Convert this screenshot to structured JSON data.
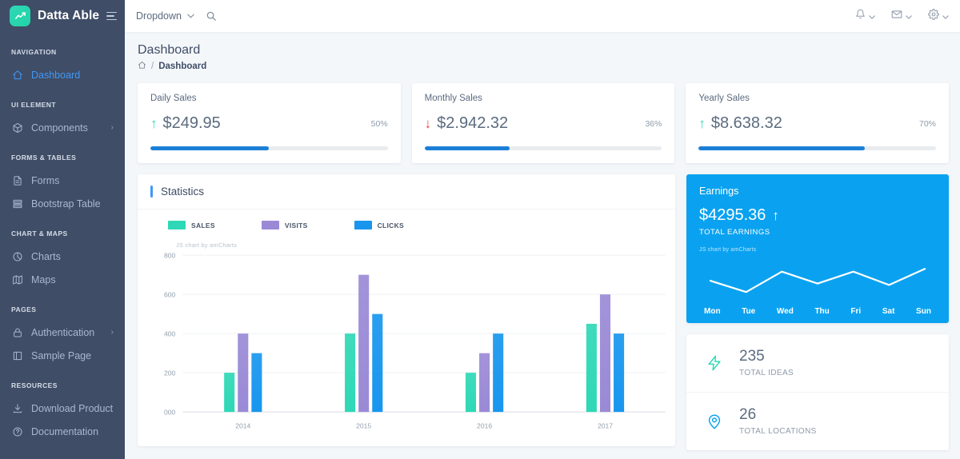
{
  "sidebar": {
    "brand": "Datta Able",
    "groups": [
      {
        "caption": "NAVIGATION",
        "items": [
          {
            "label": "Dashboard",
            "icon": "home-icon",
            "active": true,
            "arrow": ""
          }
        ]
      },
      {
        "caption": "UI ELEMENT",
        "items": [
          {
            "label": "Components",
            "icon": "cube-icon",
            "active": false,
            "arrow": "›"
          }
        ]
      },
      {
        "caption": "FORMS & TABLES",
        "items": [
          {
            "label": "Forms",
            "icon": "form-icon",
            "active": false,
            "arrow": ""
          },
          {
            "label": "Bootstrap Table",
            "icon": "table-icon",
            "active": false,
            "arrow": ""
          }
        ]
      },
      {
        "caption": "CHART & MAPS",
        "items": [
          {
            "label": "Charts",
            "icon": "pie-chart-icon",
            "active": false,
            "arrow": ""
          },
          {
            "label": "Maps",
            "icon": "map-icon",
            "active": false,
            "arrow": ""
          }
        ]
      },
      {
        "caption": "PAGES",
        "items": [
          {
            "label": "Authentication",
            "icon": "lock-icon",
            "active": false,
            "arrow": "›"
          },
          {
            "label": "Sample Page",
            "icon": "page-icon",
            "active": false,
            "arrow": ""
          }
        ]
      },
      {
        "caption": "RESOURCES",
        "items": [
          {
            "label": "Download Product",
            "icon": "download-icon",
            "active": false,
            "arrow": ""
          },
          {
            "label": "Documentation",
            "icon": "help-circle-icon",
            "active": false,
            "arrow": ""
          }
        ]
      }
    ]
  },
  "topbar": {
    "dropdown_label": "Dropdown",
    "caret": "⌄",
    "icons": [
      "bell-icon",
      "envelope-icon",
      "gear-icon"
    ]
  },
  "header": {
    "title": "Dashboard",
    "breadcrumb_home_icon": "home-icon",
    "breadcrumb_separator": "/",
    "breadcrumb_current": "Dashboard"
  },
  "stat_cards": [
    {
      "title": "Daily Sales",
      "amount": "$249.95",
      "percent": "50%",
      "progress": 50,
      "direction": "up",
      "arrow": "↑",
      "arrow_color": "#2ed8b6"
    },
    {
      "title": "Monthly Sales",
      "amount": "$2.942.32",
      "percent": "36%",
      "progress": 36,
      "direction": "down",
      "arrow": "↓",
      "arrow_color": "#f44236"
    },
    {
      "title": "Yearly Sales",
      "amount": "$8.638.32",
      "percent": "70%",
      "progress": 70,
      "direction": "up",
      "arrow": "↑",
      "arrow_color": "#2ed8b6"
    }
  ],
  "statistics": {
    "title": "Statistics",
    "watermark": "JS chart by amCharts"
  },
  "earnings": {
    "title": "Earnings",
    "amount": "$4295.36",
    "arrow": "↑",
    "subtitle": "TOTAL EARNINGS",
    "watermark": "JS chart by amCharts"
  },
  "mini_cards": [
    {
      "number": "235",
      "label": "TOTAL IDEAS",
      "icon": "lightning-bolt-icon",
      "color": "#2ed8b6"
    },
    {
      "number": "26",
      "label": "TOTAL LOCATIONS",
      "icon": "map-pin-icon",
      "color": "#0aa2f0"
    }
  ],
  "chart_data": [
    {
      "type": "bar",
      "title": "Statistics",
      "categories": [
        "2014",
        "2015",
        "2016",
        "2017"
      ],
      "series": [
        {
          "name": "SALES",
          "color": "#2ed8b6",
          "values": [
            200,
            400,
            200,
            450
          ]
        },
        {
          "name": "VISITS",
          "color": "#9a8ad6",
          "values": [
            400,
            700,
            300,
            600
          ]
        },
        {
          "name": "CLICKS",
          "color": "#1896ee",
          "values": [
            300,
            500,
            400,
            400
          ]
        }
      ],
      "ytick_labels": [
        "000",
        "200",
        "400",
        "600",
        "800"
      ],
      "ylim": [
        0,
        800
      ],
      "xlabel": "",
      "ylabel": "",
      "grid": true,
      "legend_position": "top-left"
    },
    {
      "type": "line",
      "title": "Earnings",
      "categories": [
        "Mon",
        "Tue",
        "Wed",
        "Thu",
        "Fri",
        "Sat",
        "Sun"
      ],
      "series": [
        {
          "name": "Earnings",
          "color": "#ffffff",
          "values": [
            52,
            20,
            78,
            44,
            78,
            40,
            86
          ]
        }
      ],
      "ylim": [
        0,
        100
      ],
      "grid": false,
      "legend_position": "none"
    }
  ]
}
